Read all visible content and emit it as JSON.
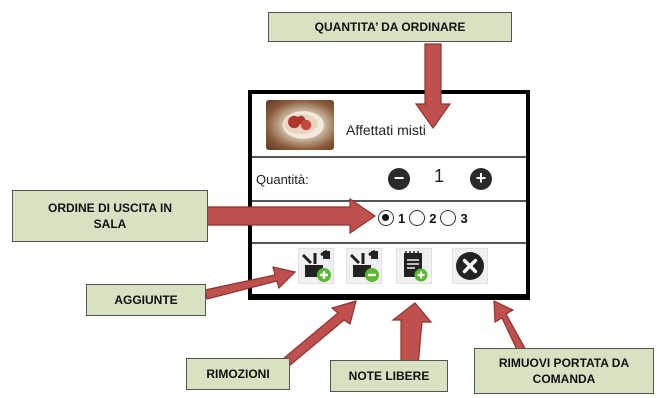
{
  "dialog": {
    "product": {
      "name": "Affettati misti"
    },
    "quantity": {
      "label": "Quantità:",
      "value": "1",
      "decrease_icon": "minus-circle-icon",
      "increase_icon": "plus-circle-icon"
    },
    "exit_order": {
      "options": [
        "1",
        "2",
        "3"
      ],
      "selected": "1"
    },
    "actions": [
      {
        "name": "add-ingredients-button",
        "icon": "grill-plus-icon"
      },
      {
        "name": "remove-ingredients-button",
        "icon": "grill-minus-icon"
      },
      {
        "name": "free-notes-button",
        "icon": "notepad-plus-icon"
      },
      {
        "name": "remove-dish-button",
        "icon": "close-circle-icon"
      }
    ]
  },
  "callouts": {
    "quantity": "QUANTITA’ DA ORDINARE",
    "exit_order_line1": "ORDINE DI USCITA IN",
    "exit_order_line2": "SALA",
    "additions": "AGGIUNTE",
    "removals": "RIMOZIONI",
    "notes": "NOTE LIBERE",
    "remove_dish_line1": "RIMUOVI PORTATA DA",
    "remove_dish_line2": "COMANDA"
  },
  "colors": {
    "callout_bg": "#d8e2c2",
    "arrow": "#c0504d",
    "arrow_border": "#8c3431"
  }
}
